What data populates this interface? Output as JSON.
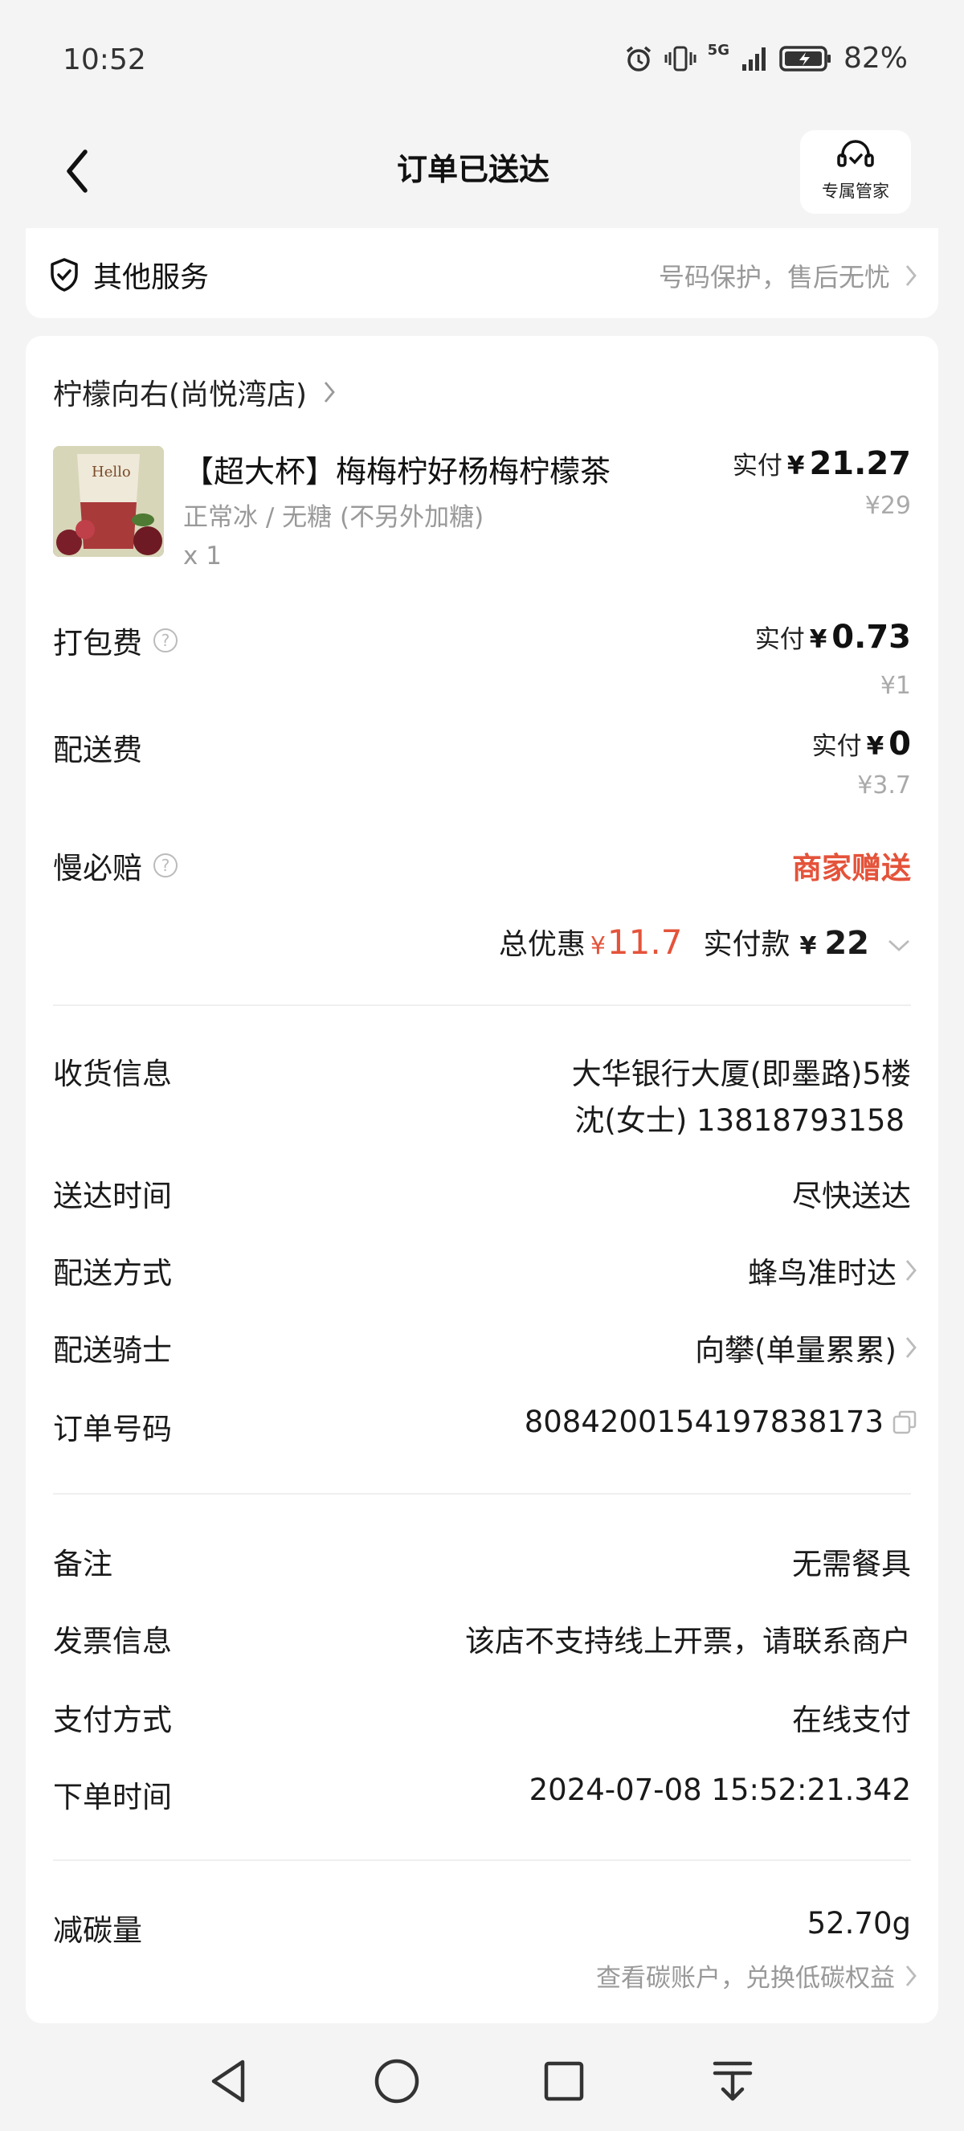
{
  "status_bar": {
    "time": "10:52",
    "network": "5G",
    "battery": "82%"
  },
  "nav": {
    "title": "订单已送达",
    "butler_label": "专属管家"
  },
  "services": {
    "title": "其他服务",
    "subtitle": "号码保护，售后无忧"
  },
  "shop": {
    "name": "柠檬向右(尚悦湾店)"
  },
  "product": {
    "name": "【超大杯】梅梅柠好杨梅柠檬茶",
    "spec": "正常冰 / 无糖 (不另外加糖)",
    "qty": "x 1",
    "paid_label": "实付",
    "currency": "¥",
    "paid": "21.27",
    "original": "¥29",
    "image_text": "Hello"
  },
  "packing": {
    "label": "打包费",
    "paid_label": "实付",
    "currency": "¥",
    "paid": "0.73",
    "original": "¥1"
  },
  "delivery_fee": {
    "label": "配送费",
    "paid_label": "实付",
    "currency": "¥",
    "paid": "0",
    "original": "¥3.7"
  },
  "slow_comp": {
    "label": "慢必赔",
    "value": "商家赠送"
  },
  "totals": {
    "discount_label": "总优惠",
    "currency": "¥",
    "discount": "11.7",
    "paid_label": "实付款",
    "paid": "22"
  },
  "info": {
    "receiver_label": "收货信息",
    "receiver_address": "大华银行大厦(即墨路)5楼",
    "receiver_contact": "沈(女士) 13818793158",
    "time_label": "送达时间",
    "time_value": "尽快送达",
    "method_label": "配送方式",
    "method_value": "蜂鸟准时达",
    "rider_label": "配送骑士",
    "rider_value": "向攀(单量累累)",
    "order_label": "订单号码",
    "order_value": "8084200154197838173"
  },
  "extra": {
    "note_label": "备注",
    "note_value": "无需餐具",
    "invoice_label": "发票信息",
    "invoice_value": "该店不支持线上开票，请联系商户",
    "pay_label": "支付方式",
    "pay_value": "在线支付",
    "order_time_label": "下单时间",
    "order_time_value": "2024-07-08 15:52:21.342"
  },
  "carbon": {
    "label": "减碳量",
    "value": "52.70g",
    "link": "查看碳账户，兑换低碳权益"
  },
  "colors": {
    "accent_red": "#e4533a",
    "muted": "#999999",
    "background": "#f4f4f4"
  }
}
